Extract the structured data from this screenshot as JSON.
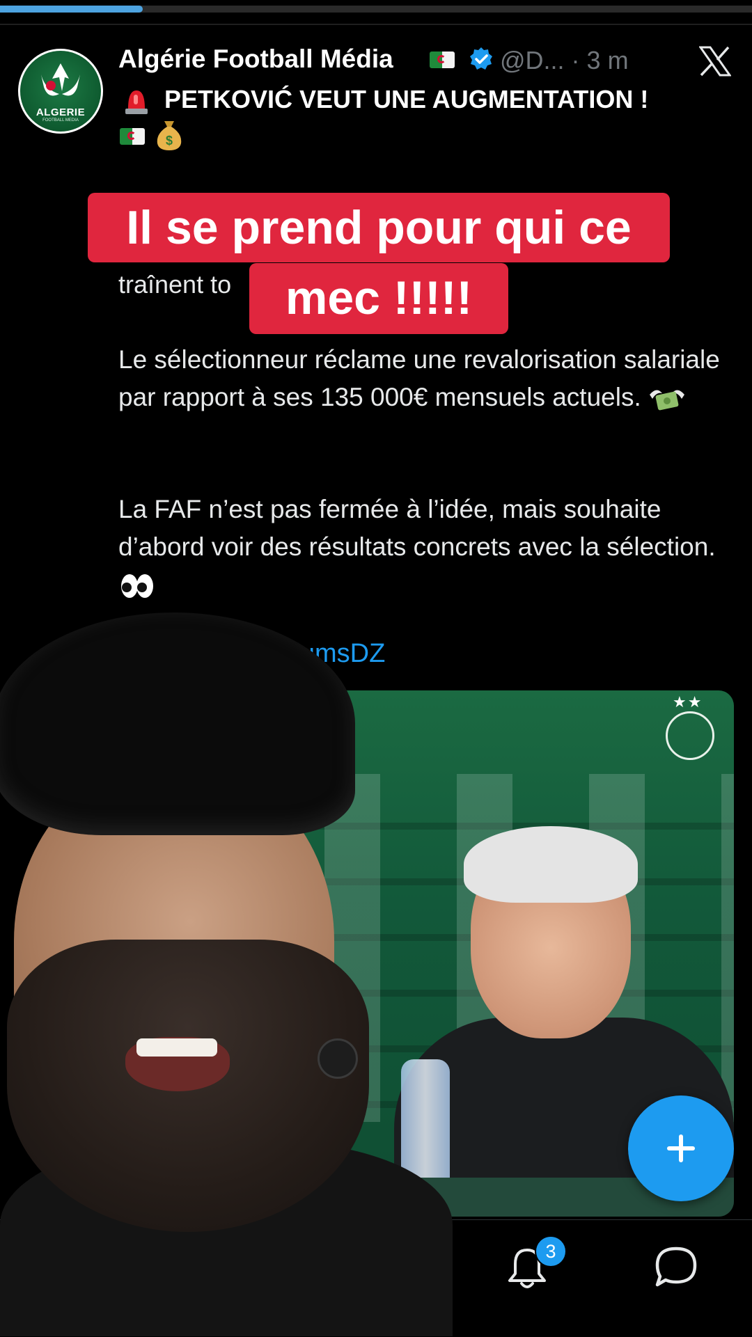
{
  "video_progress_fraction": 0.19,
  "tweet": {
    "account_name": "Algérie Football Média",
    "handle_time": "@D... · 3 m",
    "headline": "PETKOVIĆ VEUT UNE AUGMENTATION !",
    "partial_line": "traînent to",
    "paragraph_1": "Le sélectionneur réclame une revalorisation salariale par rapport à ses 135 000€ mensuels actuels.",
    "paragraph_2": "La FAF n’est pas fermée à l’idée, mais souhaite d’abord voir des résultats concrets avec la sélection.",
    "link_partial": "liumsDZ",
    "avatar_text": "ALGERIE",
    "avatar_sub": "FOOTBALL MEDIA"
  },
  "caption": {
    "line1": "Il se prend pour qui ce",
    "line2": "mec !!!!!"
  },
  "image": {
    "faf_stars": "★★"
  },
  "bottom_nav": {
    "notifications_badge": "3"
  },
  "colors": {
    "accent": "#1d9bf0",
    "caption_bg": "#e0263e",
    "background": "#000000"
  },
  "icons": {
    "verified": "verified-badge-icon",
    "x_logo": "x-logo-icon",
    "siren": "siren-emoji-icon",
    "money_bag": "money-bag-emoji-icon",
    "money_wings": "money-with-wings-emoji-icon",
    "eyes": "eyes-emoji-icon",
    "flag": "algeria-flag-icon",
    "compose": "plus-icon",
    "bell": "bell-icon",
    "messages": "message-bubble-icon"
  }
}
